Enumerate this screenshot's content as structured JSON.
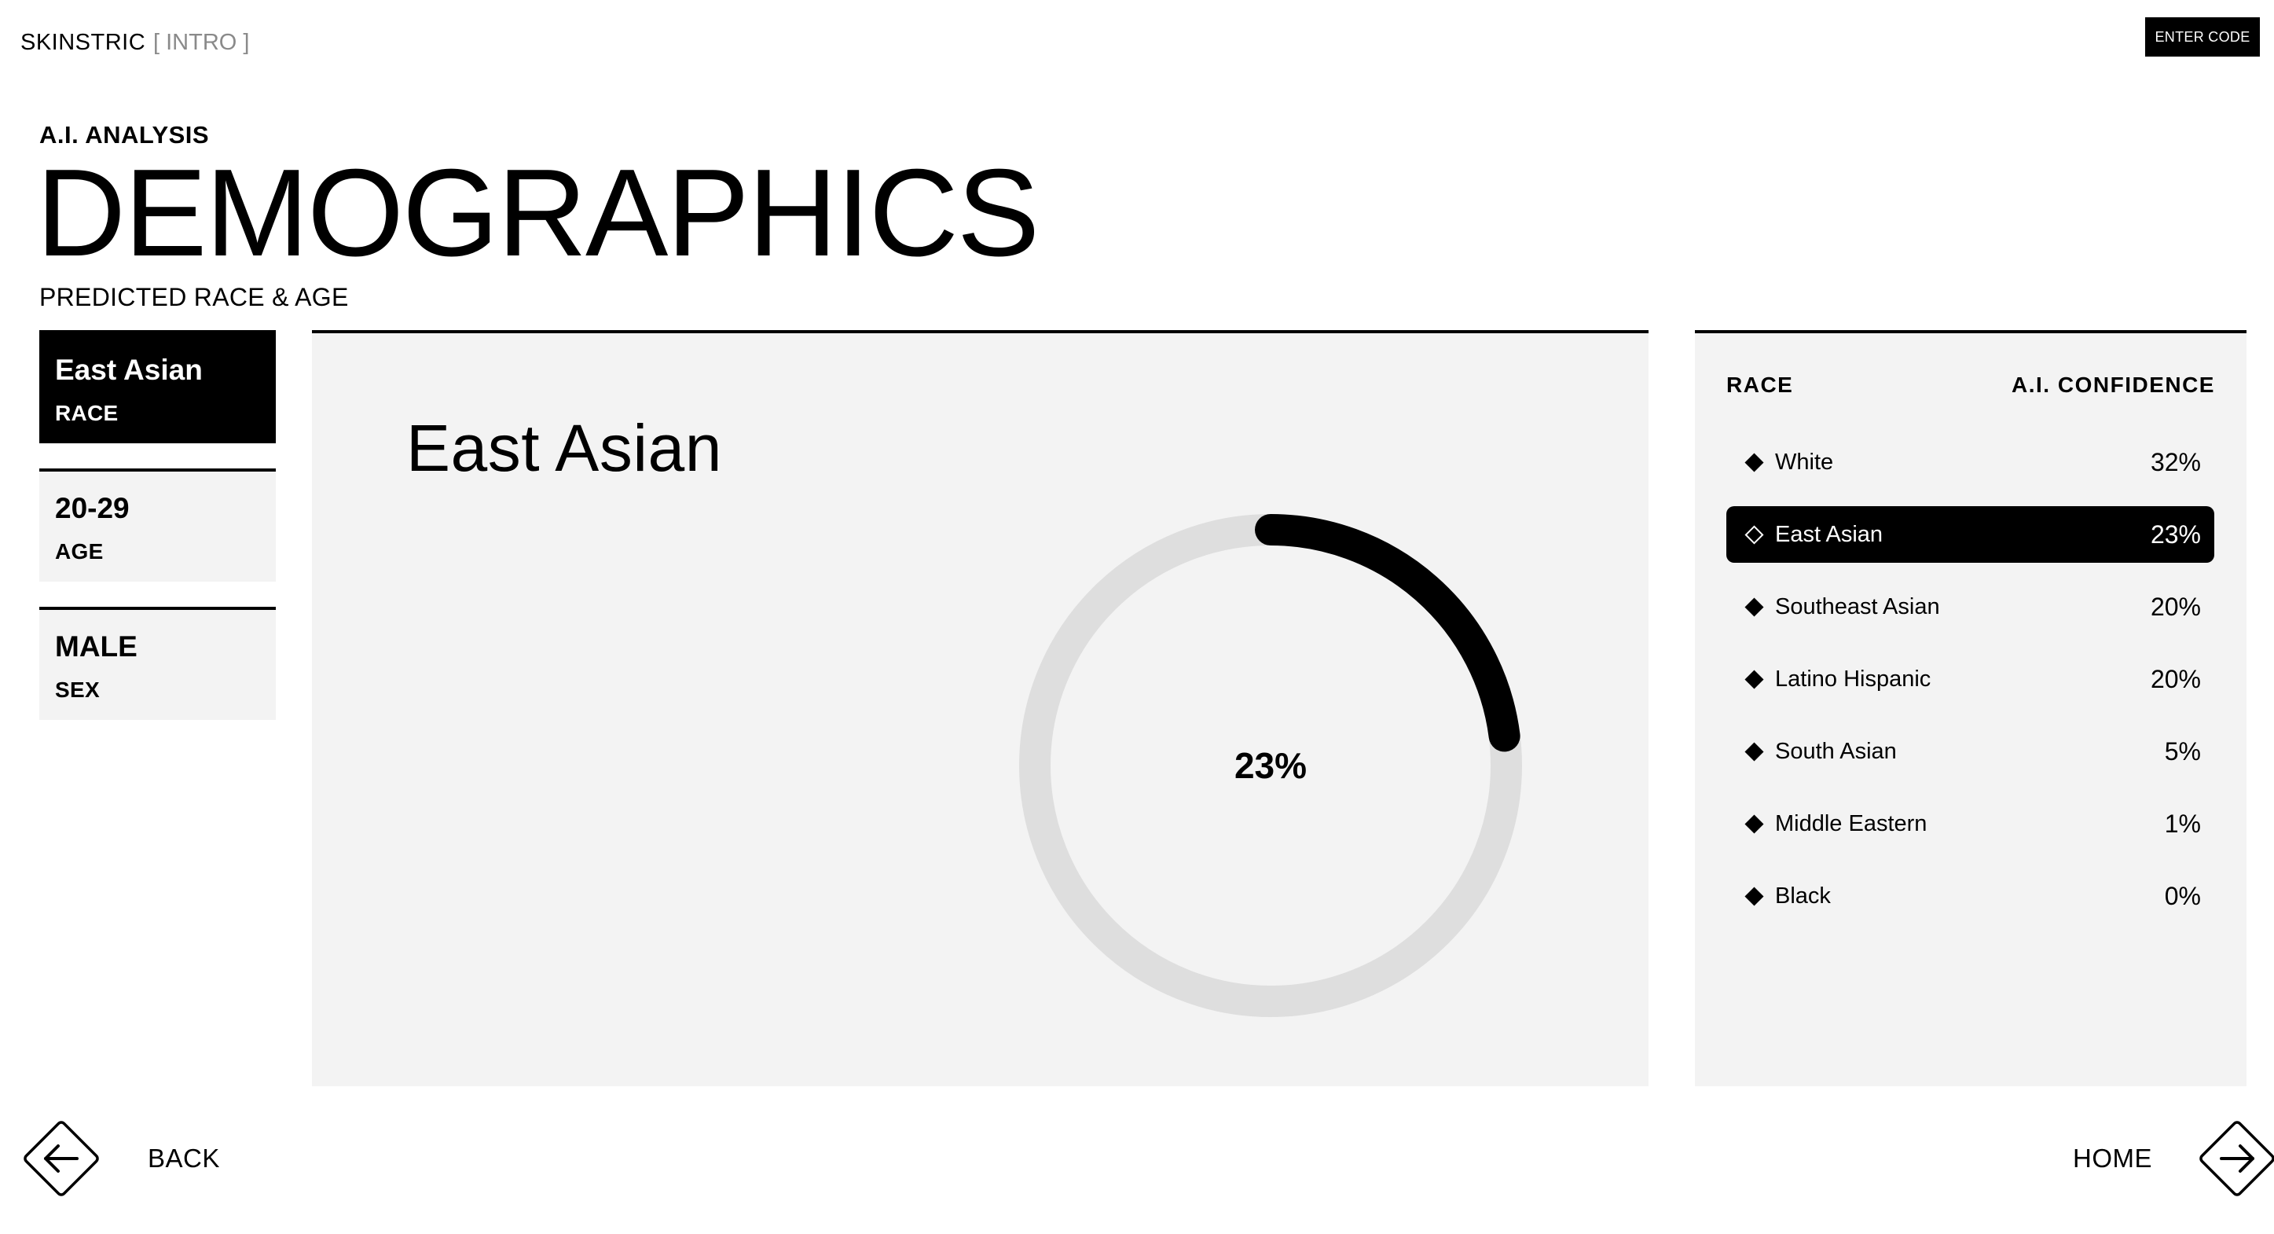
{
  "header": {
    "brand": "SKINSTRIC",
    "section": "[ INTRO ]",
    "enter_code_label": "ENTER CODE"
  },
  "page": {
    "kicker": "A.I. ANALYSIS",
    "title": "DEMOGRAPHICS",
    "subtitle": "PREDICTED RACE & AGE"
  },
  "summary_tiles": [
    {
      "value": "East Asian",
      "label": "RACE",
      "active": true
    },
    {
      "value": "20-29",
      "label": "AGE",
      "active": false
    },
    {
      "value": "MALE",
      "label": "SEX",
      "active": false
    }
  ],
  "detail": {
    "title": "East Asian",
    "percent_label": "23%",
    "percent_value": 0.23
  },
  "confidence_table": {
    "col_race": "RACE",
    "col_confidence": "A.I. CONFIDENCE",
    "rows": [
      {
        "name": "White",
        "pct": "32%",
        "active": false
      },
      {
        "name": "East Asian",
        "pct": "23%",
        "active": true
      },
      {
        "name": "Southeast Asian",
        "pct": "20%",
        "active": false
      },
      {
        "name": "Latino Hispanic",
        "pct": "20%",
        "active": false
      },
      {
        "name": "South Asian",
        "pct": "5%",
        "active": false
      },
      {
        "name": "Middle Eastern",
        "pct": "1%",
        "active": false
      },
      {
        "name": "Black",
        "pct": "0%",
        "active": false
      }
    ]
  },
  "footer": {
    "back_label": "BACK",
    "home_label": "HOME"
  },
  "colors": {
    "accent": "#000000",
    "panel_bg": "#f3f3f3",
    "ring_track": "#dedede",
    "muted_text": "#8a8a8a"
  }
}
